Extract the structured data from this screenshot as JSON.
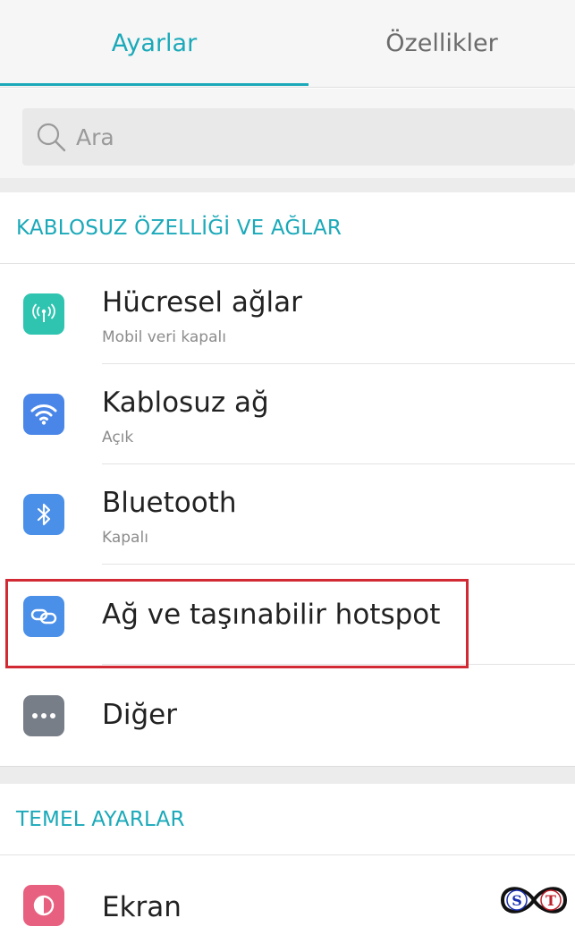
{
  "tabs": [
    {
      "label": "Ayarlar",
      "active": true
    },
    {
      "label": "Özellikler",
      "active": false
    }
  ],
  "search": {
    "placeholder": "Ara"
  },
  "sections": [
    {
      "header": "KABLOSUZ ÖZELLİĞİ VE AĞLAR",
      "items": [
        {
          "title": "Hücresel ağlar",
          "subtitle": "Mobil veri kapalı",
          "icon": "cellular-antenna-icon",
          "icon_color": "#2fc4b0"
        },
        {
          "title": "Kablosuz ağ",
          "subtitle": "Açık",
          "icon": "wifi-icon",
          "icon_color": "#4a86e8"
        },
        {
          "title": "Bluetooth",
          "subtitle": "Kapalı",
          "icon": "bluetooth-icon",
          "icon_color": "#4a8fe8"
        },
        {
          "title": "Ağ ve taşınabilir hotspot",
          "subtitle": "",
          "icon": "link-icon",
          "icon_color": "#4a8fe8",
          "highlighted": true
        },
        {
          "title": "Diğer",
          "subtitle": "",
          "icon": "more-dots-icon",
          "icon_color": "#777e88"
        }
      ]
    },
    {
      "header": "TEMEL AYARLAR",
      "items": [
        {
          "title": "Ekran",
          "subtitle": "",
          "icon": "display-icon",
          "icon_color": "#e8607f"
        }
      ]
    }
  ],
  "colors": {
    "accent": "#1ba9b9",
    "highlight_border": "#d22a35"
  },
  "watermark": {
    "letters": [
      "S",
      "T"
    ]
  }
}
